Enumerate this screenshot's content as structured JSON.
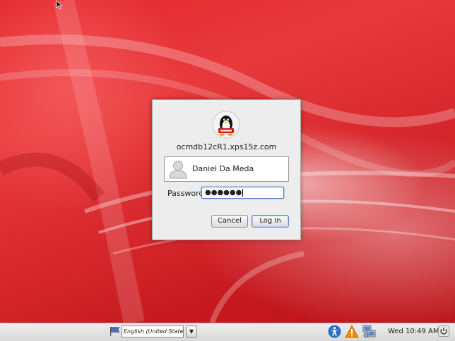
{
  "login_dialog": {
    "hostname": "ocmdb12cR1.xps15z.com",
    "user_name": "Daniel Da Meda",
    "password_label": "Password:",
    "password_value": "●●●●●●",
    "cancel_label": "Cancel",
    "login_label": "Log In",
    "logo_icon": "oracle-linux-tux-icon"
  },
  "panel": {
    "language": "English (United States)",
    "dropdown_glyph": "▼",
    "clock": "Wed 10:49 AM",
    "icons": [
      "keyboard-flag-icon",
      "accessibility-icon",
      "warning-icon",
      "network-icon",
      "shutdown-icon"
    ]
  },
  "colors": {
    "desktop_red": "#e3262c",
    "dialog_bg": "#ededed",
    "focus_blue": "#4a7bc6",
    "warning_orange": "#f08a00",
    "accessibility_blue": "#2b6fc4"
  }
}
